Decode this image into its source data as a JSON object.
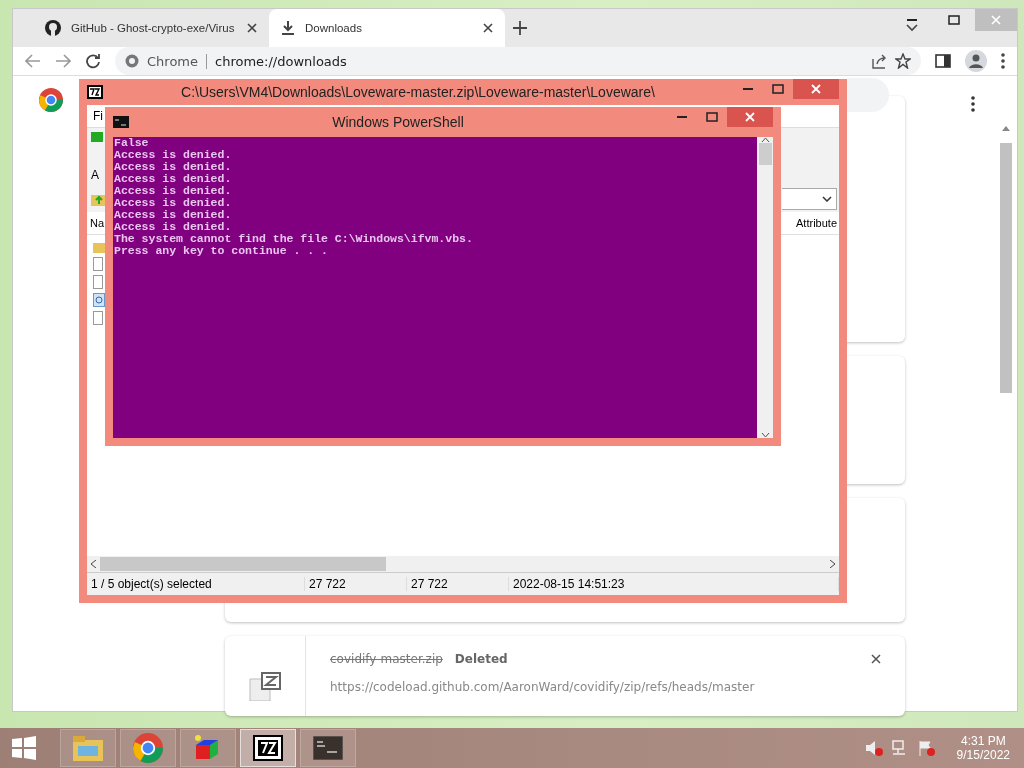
{
  "browser": {
    "tabs": [
      {
        "title": "GitHub - Ghost-crypto-exe/Virus",
        "kind": "github",
        "selected": false
      },
      {
        "title": "Downloads",
        "kind": "download",
        "selected": true
      }
    ],
    "address": {
      "site": "Chrome",
      "url": "chrome://downloads"
    },
    "downloads": [
      {
        "filename": "covidify-master.zip",
        "status": "Deleted",
        "url": "https://codeload.github.com/AaronWard/covidify/zip/refs/heads/master"
      }
    ]
  },
  "archive_window": {
    "title": "C:\\Users\\VM4\\Downloads\\Loveware-master.zip\\Loveware-master\\Loveware\\",
    "menu": [
      "Fi"
    ],
    "toolbar": [
      "A"
    ],
    "columns": [
      "Na",
      "Attribute"
    ],
    "status": [
      "1 / 5 object(s) selected",
      "27 722",
      "27 722",
      "2022-08-15 14:51:23"
    ]
  },
  "console_window": {
    "title": "Windows PowerShell",
    "lines": [
      "False",
      "Access is denied.",
      "Access is denied.",
      "Access is denied.",
      "Access is denied.",
      "Access is denied.",
      "Access is denied.",
      "Access is denied.",
      "The system cannot find the file C:\\Windows\\ifvm.vbs.",
      "Press any key to continue . . ."
    ]
  },
  "taskbar": {
    "apps": [
      {
        "kind": "explorer",
        "selected": false
      },
      {
        "kind": "chrome",
        "selected": false
      },
      {
        "kind": "cube",
        "selected": false
      },
      {
        "kind": "sevenzip",
        "selected": true
      },
      {
        "kind": "console",
        "selected": false
      }
    ],
    "time": "4:31 PM",
    "date": "9/15/2022"
  }
}
